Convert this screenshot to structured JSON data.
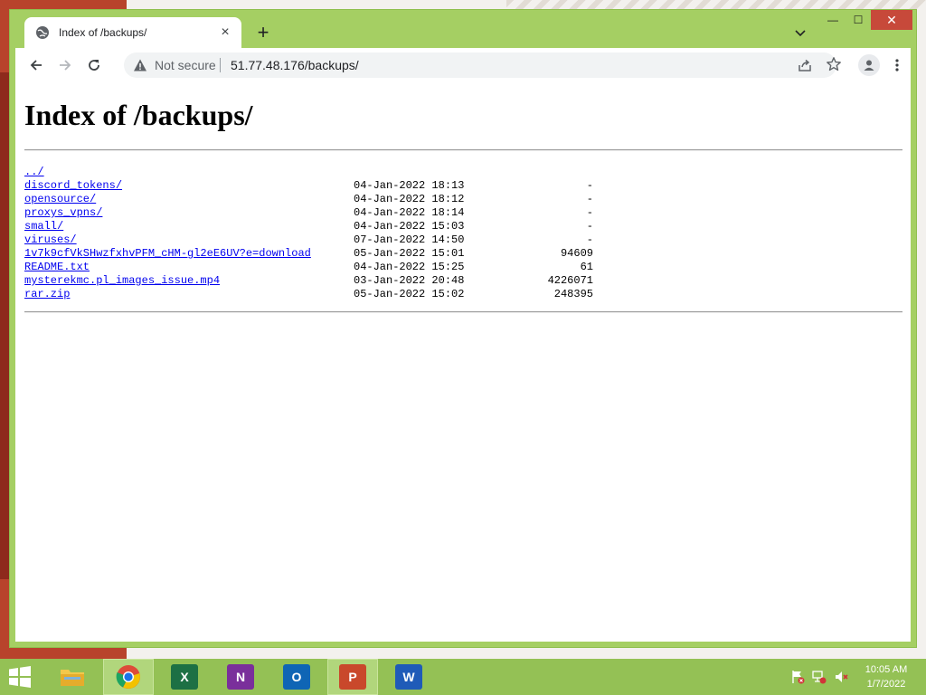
{
  "browser": {
    "tab": {
      "title": "Index of /backups/",
      "favicon": "globe-icon",
      "close_glyph": "×"
    },
    "new_tab_glyph": "+",
    "window_controls": {
      "minimize": "—",
      "maximize": "☐",
      "close": "✕"
    },
    "omnibox": {
      "security_label": "Not secure",
      "url": "51.77.48.176/backups/"
    },
    "colors": {
      "frame": "#a5cf63",
      "close_button": "#c7493a"
    }
  },
  "page": {
    "heading": "Index of /backups/",
    "entries": [
      {
        "name": "../",
        "date": "",
        "size": ""
      },
      {
        "name": "discord_tokens/",
        "date": "04-Jan-2022 18:13",
        "size": "-"
      },
      {
        "name": "opensource/",
        "date": "04-Jan-2022 18:12",
        "size": "-"
      },
      {
        "name": "proxys_vpns/",
        "date": "04-Jan-2022 18:14",
        "size": "-"
      },
      {
        "name": "small/",
        "date": "04-Jan-2022 15:03",
        "size": "-"
      },
      {
        "name": "viruses/",
        "date": "07-Jan-2022 14:50",
        "size": "-"
      },
      {
        "name": "1v7k9cfVkSHwzfxhvPFM_cHM-gl2eE6UV?e=download",
        "date": "05-Jan-2022 15:01",
        "size": "94609"
      },
      {
        "name": "README.txt",
        "date": "04-Jan-2022 15:25",
        "size": "61"
      },
      {
        "name": "mysterekmc.pl_images_issue.mp4",
        "date": "03-Jan-2022 20:48",
        "size": "4226071"
      },
      {
        "name": "rar.zip",
        "date": "05-Jan-2022 15:02",
        "size": "248395"
      }
    ]
  },
  "taskbar": {
    "apps": [
      {
        "name": "file-explorer",
        "icon": "folder-icon",
        "letter": "",
        "color": "#e8b83c",
        "active": false
      },
      {
        "name": "chrome",
        "icon": "chrome-icon",
        "letter": "",
        "color": "#dd4b39",
        "active": true
      },
      {
        "name": "excel",
        "icon": "excel-icon",
        "letter": "X",
        "color": "#1d7044",
        "active": false
      },
      {
        "name": "onenote",
        "icon": "onenote-icon",
        "letter": "N",
        "color": "#7a2f9b",
        "active": false
      },
      {
        "name": "outlook",
        "icon": "outlook-icon",
        "letter": "O",
        "color": "#0f65b5",
        "active": false
      },
      {
        "name": "powerpoint",
        "icon": "powerpoint-icon",
        "letter": "P",
        "color": "#c9482b",
        "active": true
      },
      {
        "name": "word",
        "icon": "word-icon",
        "letter": "W",
        "color": "#1f5bb8",
        "active": false
      }
    ],
    "tray": [
      "action-center-flag-icon",
      "network-icon",
      "volume-muted-icon"
    ],
    "clock": {
      "time": "10:05 AM",
      "date": "1/7/2022"
    }
  }
}
